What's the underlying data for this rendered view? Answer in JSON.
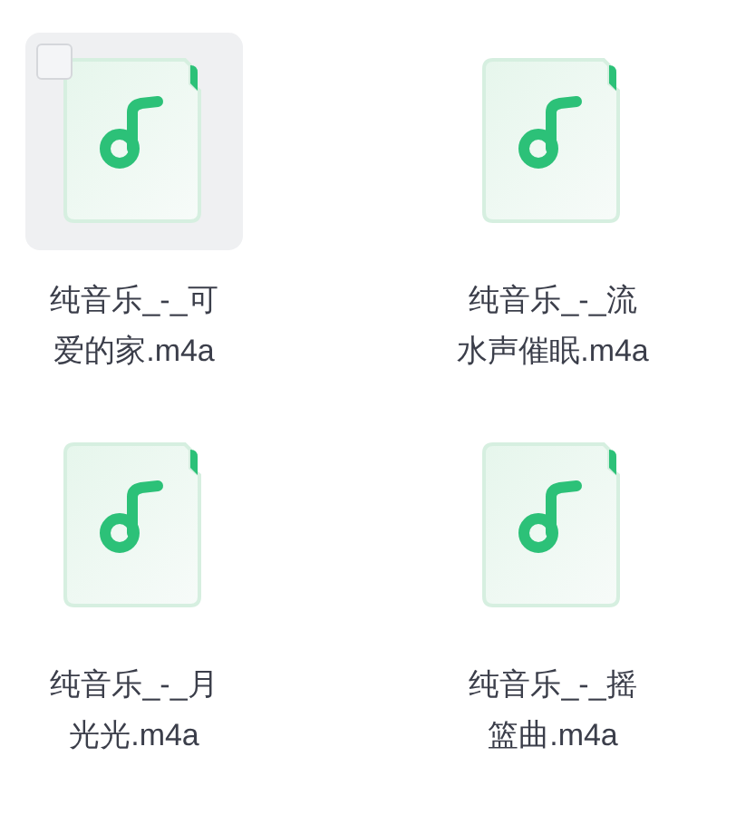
{
  "files": [
    {
      "name": "纯音乐_-_可爱的家.m4a",
      "hovered": true,
      "checked": false
    },
    {
      "name": "纯音乐_-_流水声催眠.m4a",
      "hovered": false,
      "checked": false
    },
    {
      "name": "纯音乐_-_月光光.m4a",
      "hovered": false,
      "checked": false
    },
    {
      "name": "纯音乐_-_摇篮曲.m4a",
      "hovered": false,
      "checked": false
    }
  ]
}
